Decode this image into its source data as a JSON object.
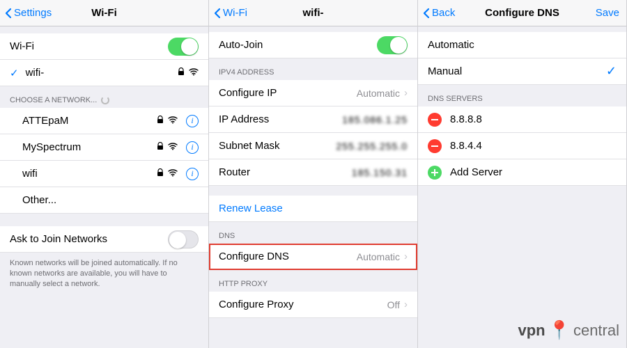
{
  "panel1": {
    "back": "Settings",
    "title": "Wi-Fi",
    "wifi_label": "Wi-Fi",
    "connected_network": "wifi-",
    "choose_header": "CHOOSE A NETWORK...",
    "networks": [
      "ATTEpaM",
      "MySpectrum",
      "wifi",
      "Other..."
    ],
    "ask_label": "Ask to Join Networks",
    "ask_footer": "Known networks will be joined automatically. If no known networks are available, you will have to manually select a network."
  },
  "panel2": {
    "back": "Wi-Fi",
    "title": "wifi-",
    "autojoin": "Auto-Join",
    "ipv4_header": "IPV4 ADDRESS",
    "configure_ip_label": "Configure IP",
    "configure_ip_value": "Automatic",
    "ip_label": "IP Address",
    "ip_value": "185.086.1.25",
    "subnet_label": "Subnet Mask",
    "subnet_value": "255.255.255.0",
    "router_label": "Router",
    "router_value": "185.150.31",
    "renew": "Renew Lease",
    "dns_header": "DNS",
    "configure_dns_label": "Configure DNS",
    "configure_dns_value": "Automatic",
    "proxy_header": "HTTP PROXY",
    "configure_proxy_label": "Configure Proxy",
    "configure_proxy_value": "Off"
  },
  "panel3": {
    "back": "Back",
    "title": "Configure DNS",
    "save": "Save",
    "automatic": "Automatic",
    "manual": "Manual",
    "servers_header": "DNS SERVERS",
    "servers": [
      "8.8.8.8",
      "8.8.4.4"
    ],
    "add": "Add Server"
  },
  "watermark": {
    "vpn": "vpn",
    "central": "central"
  }
}
